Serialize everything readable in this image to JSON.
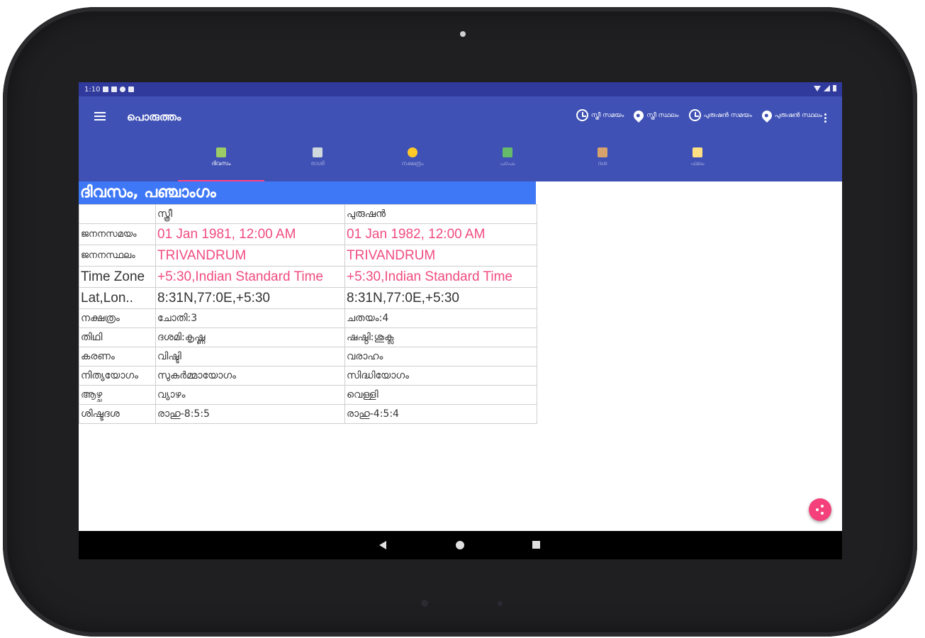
{
  "status": {
    "time": "1:10"
  },
  "app": {
    "title": "പൊരുത്തം"
  },
  "actions": [
    {
      "label": "സ്ത്രീ സമയം",
      "icon": "clock-icon"
    },
    {
      "label": "സ്ത്രീ സ്ഥലം",
      "icon": "location-pin-icon"
    },
    {
      "label": "പുരുഷൻ സമയം",
      "icon": "clock-icon"
    },
    {
      "label": "പുരുഷൻ സ്ഥലം",
      "icon": "location-pin-icon"
    }
  ],
  "tabs": [
    {
      "label": "ദിവസം",
      "icon": "calendar-icon",
      "color": "#9ccc65",
      "active": true
    },
    {
      "label": "രാശി",
      "icon": "chart-icon",
      "color": "#cfd8dc"
    },
    {
      "label": "നക്ഷത്രം",
      "icon": "stars-icon",
      "color": "#ffca28"
    },
    {
      "label": "പാപം",
      "icon": "grid-icon",
      "color": "#66bb6a"
    },
    {
      "label": "ദശ",
      "icon": "book-icon",
      "color": "#d7a26b"
    },
    {
      "label": "ഫലം",
      "icon": "notes-icon",
      "color": "#ffe082"
    }
  ],
  "content": {
    "section_title": "ദിവസം, പഞ്ചാംഗം",
    "header": [
      "",
      "സ്ത്രീ",
      "പുരുഷൻ"
    ],
    "rows": [
      {
        "label": "ജനനസമയം",
        "female": "01 Jan 1981, 12:00 AM",
        "male": "01 Jan 1982, 12:00 AM"
      },
      {
        "label": "ജനനസ്ഥലം",
        "female": "TRIVANDRUM",
        "male": "TRIVANDRUM"
      },
      {
        "label": "Time Zone",
        "female": "+5:30,Indian Standard Time",
        "male": "+5:30,Indian Standard Time"
      },
      {
        "label": "Lat,Lon..",
        "female": "8:31N,77:0E,+5:30",
        "male": "8:31N,77:0E,+5:30"
      },
      {
        "label": "നക്ഷത്രം",
        "female": "ചോതി:3",
        "male": "ചതയം:4"
      },
      {
        "label": "തിഥി",
        "female": "ദശമി:കൃഷ്ണ",
        "male": "ഷഷ്ഠി:ശുക്ല"
      },
      {
        "label": "കരണം",
        "female": "വിഷ്ടി",
        "male": "വരാഹം"
      },
      {
        "label": "നിത്യയോഗം",
        "female": "സുകർമ്മായോഗം",
        "male": "സിദ്ധിയോഗം"
      },
      {
        "label": "ആഴ്ച",
        "female": "വ്യാഴം",
        "male": "വെള്ളി"
      },
      {
        "label": "ശിഷ്ടദശ",
        "female": "രാഹു-8:5:5",
        "male": "രാഹു-4:5:4"
      }
    ]
  },
  "colors": {
    "primary": "#3f51b5",
    "status_bar": "#30399c",
    "section_header": "#3f78f6",
    "accent": "#f04c80",
    "fab": "#f4417b"
  }
}
